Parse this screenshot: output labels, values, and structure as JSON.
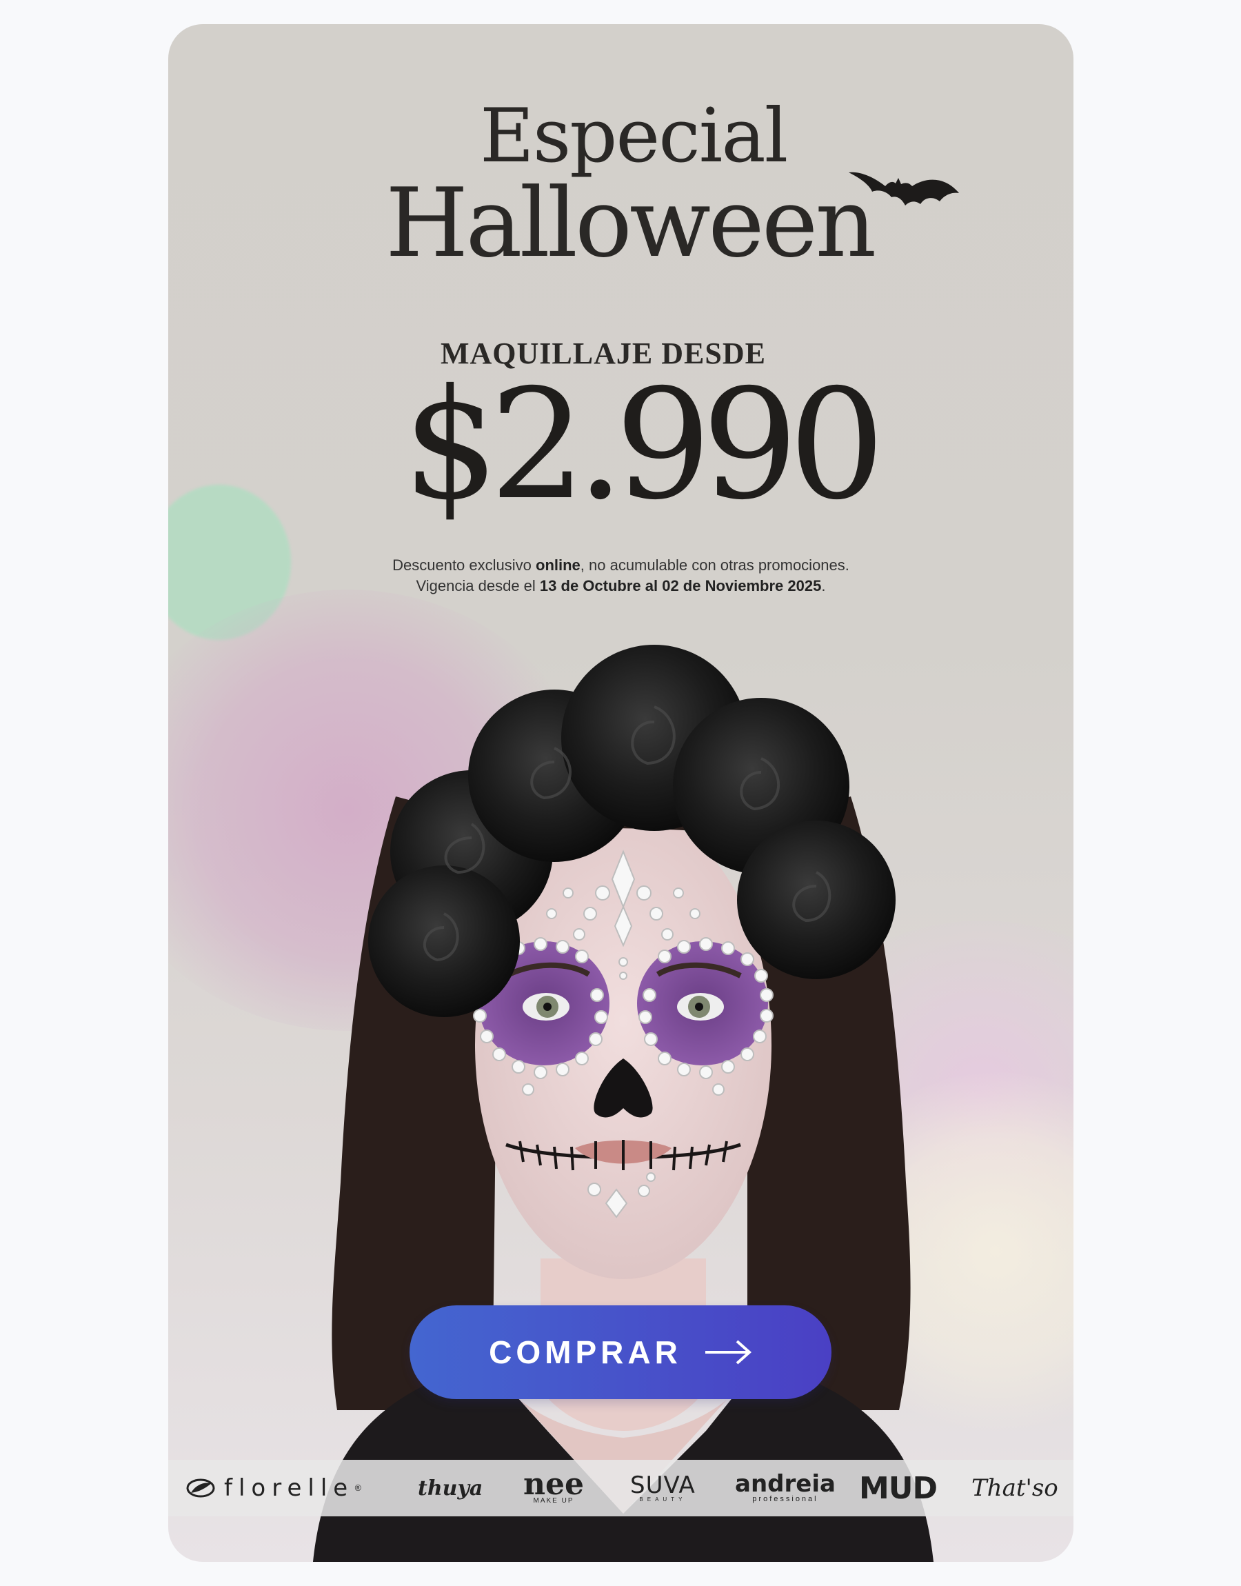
{
  "header": {
    "title_line1": "Especial",
    "title_line2": "Halloween"
  },
  "promo": {
    "subtitle": "MAQUILLAJE DESDE",
    "price": "$2.990"
  },
  "disclaimer": {
    "line1_pre": "Descuento exclusivo ",
    "line1_bold": "online",
    "line1_post": ", no acumulable con otras promociones.",
    "line2_pre": "Vigencia desde el ",
    "line2_bold": "13 de Octubre al 02 de Noviembre 2025",
    "line2_post": "."
  },
  "cta": {
    "label": "COMPRAR",
    "icon": "arrow-right-icon"
  },
  "brands": {
    "florelle": "florelle",
    "florelle_mark": "®",
    "thuya": "thuya",
    "nee": "nee",
    "nee_sub": "MAKE UP",
    "suva": "SUVA",
    "suva_sub": "BEAUTY",
    "andreia": "andreia",
    "andreia_sub": "professional",
    "mud": "MUD",
    "thatso": "That'so"
  },
  "colors": {
    "card_bg": "#d3d0cb",
    "cta_start": "#4466d0",
    "cta_end": "#4a40c4",
    "text_dark": "#2a2826"
  }
}
